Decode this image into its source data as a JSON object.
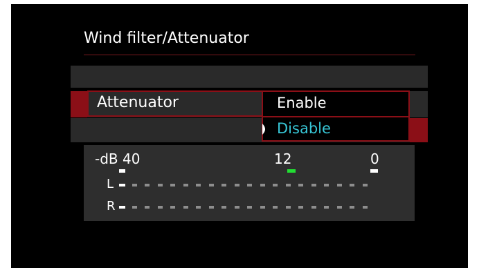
{
  "screen": {
    "title": "Wind filter/Attenuator"
  },
  "setting": {
    "label": "Attenuator",
    "options": [
      "Enable",
      "Disable"
    ],
    "selected": "Disable"
  },
  "meter": {
    "scale_label": "-dB 40",
    "mid_label": "12",
    "right_label": "0",
    "channels": [
      "L",
      "R"
    ],
    "segments_per_channel": 20
  },
  "colors": {
    "accent_red": "#8b0f17",
    "selected_text": "#37c6d6",
    "mid_tick": "#22dd33"
  }
}
